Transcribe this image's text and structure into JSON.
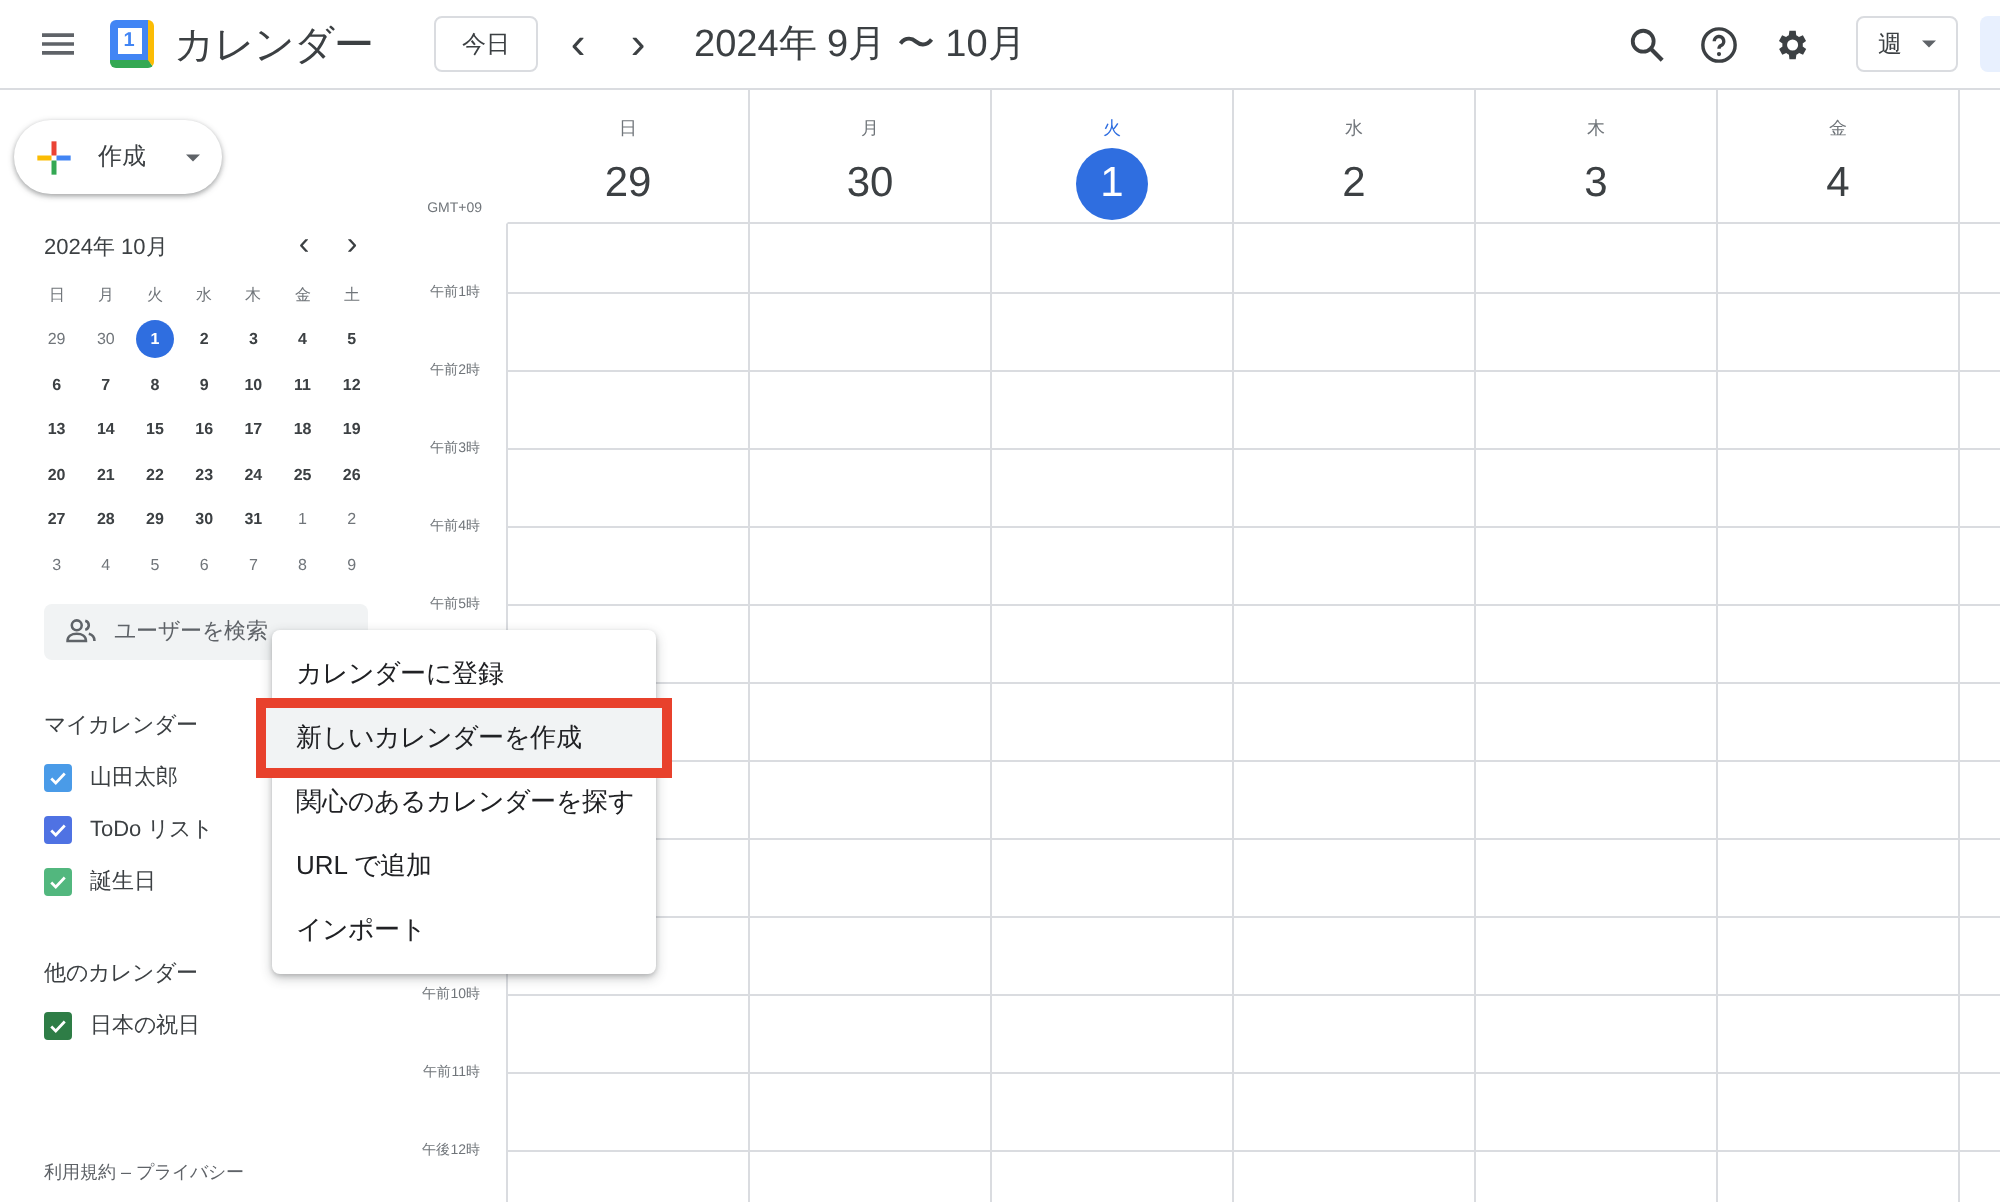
{
  "header": {
    "logo_digit": "1",
    "app_name": "カレンダー",
    "today_button": "今日",
    "prev": "‹",
    "next": "›",
    "date_range": "2024年 9月 〜 10月",
    "view_button": "週"
  },
  "create_button": "作成",
  "mini_calendar": {
    "title": "2024年 10月",
    "weekdays": [
      "日",
      "月",
      "火",
      "水",
      "木",
      "金",
      "土"
    ],
    "weeks": [
      [
        {
          "d": "29",
          "other": true,
          "selected": false
        },
        {
          "d": "30",
          "other": true,
          "selected": false
        },
        {
          "d": "1",
          "other": false,
          "selected": true
        },
        {
          "d": "2",
          "other": false,
          "selected": false
        },
        {
          "d": "3",
          "other": false,
          "selected": false
        },
        {
          "d": "4",
          "other": false,
          "selected": false
        },
        {
          "d": "5",
          "other": false,
          "selected": false
        }
      ],
      [
        {
          "d": "6",
          "other": false,
          "selected": false
        },
        {
          "d": "7",
          "other": false,
          "selected": false
        },
        {
          "d": "8",
          "other": false,
          "selected": false
        },
        {
          "d": "9",
          "other": false,
          "selected": false
        },
        {
          "d": "10",
          "other": false,
          "selected": false
        },
        {
          "d": "11",
          "other": false,
          "selected": false
        },
        {
          "d": "12",
          "other": false,
          "selected": false
        }
      ],
      [
        {
          "d": "13",
          "other": false,
          "selected": false
        },
        {
          "d": "14",
          "other": false,
          "selected": false
        },
        {
          "d": "15",
          "other": false,
          "selected": false
        },
        {
          "d": "16",
          "other": false,
          "selected": false
        },
        {
          "d": "17",
          "other": false,
          "selected": false
        },
        {
          "d": "18",
          "other": false,
          "selected": false
        },
        {
          "d": "19",
          "other": false,
          "selected": false
        }
      ],
      [
        {
          "d": "20",
          "other": false,
          "selected": false
        },
        {
          "d": "21",
          "other": false,
          "selected": false
        },
        {
          "d": "22",
          "other": false,
          "selected": false
        },
        {
          "d": "23",
          "other": false,
          "selected": false
        },
        {
          "d": "24",
          "other": false,
          "selected": false
        },
        {
          "d": "25",
          "other": false,
          "selected": false
        },
        {
          "d": "26",
          "other": false,
          "selected": false
        }
      ],
      [
        {
          "d": "27",
          "other": false,
          "selected": false
        },
        {
          "d": "28",
          "other": false,
          "selected": false
        },
        {
          "d": "29",
          "other": false,
          "selected": false
        },
        {
          "d": "30",
          "other": false,
          "selected": false
        },
        {
          "d": "31",
          "other": false,
          "selected": false
        },
        {
          "d": "1",
          "other": true,
          "selected": false
        },
        {
          "d": "2",
          "other": true,
          "selected": false
        }
      ],
      [
        {
          "d": "3",
          "other": true,
          "selected": false
        },
        {
          "d": "4",
          "other": true,
          "selected": false
        },
        {
          "d": "5",
          "other": true,
          "selected": false
        },
        {
          "d": "6",
          "other": true,
          "selected": false
        },
        {
          "d": "7",
          "other": true,
          "selected": false
        },
        {
          "d": "8",
          "other": true,
          "selected": false
        },
        {
          "d": "9",
          "other": true,
          "selected": false
        }
      ]
    ]
  },
  "people_search": {
    "placeholder": "ユーザーを検索"
  },
  "my_calendars": {
    "title": "マイカレンダー",
    "items": [
      {
        "name": "山田太郎",
        "checked": true,
        "color": "#4a9be8"
      },
      {
        "name": "ToDo リスト",
        "checked": true,
        "color": "#4f72e3"
      },
      {
        "name": "誕生日",
        "checked": true,
        "color": "#52b77e"
      }
    ]
  },
  "other_calendars": {
    "title": "他のカレンダー",
    "items": [
      {
        "name": "日本の祝日",
        "checked": true,
        "color": "#2e7d46"
      }
    ]
  },
  "footer": "利用規約 – プライバシー",
  "timezone": "GMT+09",
  "days": [
    {
      "weekday": "日",
      "date": "29",
      "selected": false
    },
    {
      "weekday": "月",
      "date": "30",
      "selected": false
    },
    {
      "weekday": "火",
      "date": "1",
      "selected": true
    },
    {
      "weekday": "水",
      "date": "2",
      "selected": false
    },
    {
      "weekday": "木",
      "date": "3",
      "selected": false
    },
    {
      "weekday": "金",
      "date": "4",
      "selected": false
    }
  ],
  "hours_morning": [
    "午前1時",
    "午前2時",
    "午前3時",
    "午前4時",
    "午前5時"
  ],
  "hours_late": [
    "午前10時",
    "午前11時",
    "午後12時"
  ],
  "menu": [
    {
      "label": "カレンダーに登録",
      "highlighted": false
    },
    {
      "label": "新しいカレンダーを作成",
      "highlighted": true
    },
    {
      "label": "関心のあるカレンダーを探す",
      "highlighted": false
    },
    {
      "label": "URL で追加",
      "highlighted": false
    },
    {
      "label": "インポート",
      "highlighted": false
    }
  ]
}
